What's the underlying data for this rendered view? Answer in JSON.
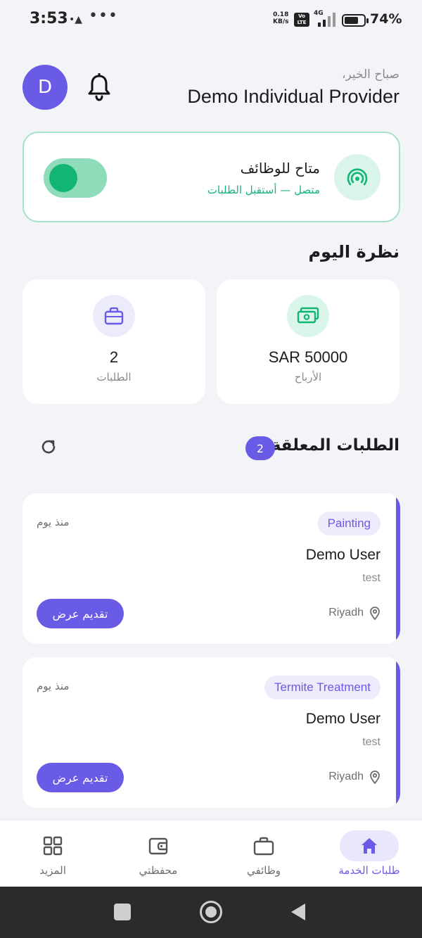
{
  "status_bar": {
    "time": "3:53",
    "extra_icon": "•▲",
    "dots": "•••",
    "speed_value": "0.18",
    "speed_unit": "KB/s",
    "volte": "Vo LTE",
    "network": "4G",
    "battery_percent": "74%",
    "battery_level": 0.74
  },
  "header": {
    "avatar_letter": "D",
    "greeting": "صباح الخير،",
    "provider_name": "Demo Individual Provider"
  },
  "availability": {
    "title": "متاح للوظائف",
    "status": "متصل — أستقبل الطلبات",
    "toggle_on": true,
    "accent_color": "#12b573"
  },
  "overview": {
    "title": "نظرة اليوم",
    "earnings": {
      "value": "SAR 50000",
      "label": "الأرباح",
      "icon": "cash-icon"
    },
    "requests": {
      "value": "2",
      "label": "الطلبات",
      "icon": "briefcase-icon"
    }
  },
  "pending": {
    "title": "الطلبات المعلقة",
    "count": "2",
    "refresh_icon": "refresh-icon"
  },
  "requests": [
    {
      "category": "Painting",
      "time_ago": "منذ يوم",
      "user": "Demo User",
      "description": "test",
      "location": "Riyadh",
      "action_label": "تقديم عرض"
    },
    {
      "category": "Termite Treatment",
      "time_ago": "منذ يوم",
      "user": "Demo User",
      "description": "test",
      "location": "Riyadh",
      "action_label": "تقديم عرض"
    }
  ],
  "bottom_nav": [
    {
      "label": "طلبات الخدمة",
      "icon": "home-icon",
      "active": true
    },
    {
      "label": "وظائفي",
      "icon": "briefcase-icon",
      "active": false
    },
    {
      "label": "محفظتي",
      "icon": "wallet-icon",
      "active": false
    },
    {
      "label": "المزيد",
      "icon": "grid-icon",
      "active": false
    }
  ],
  "colors": {
    "primary": "#6a5be6",
    "success": "#12b573",
    "background": "#f2f4f8"
  }
}
